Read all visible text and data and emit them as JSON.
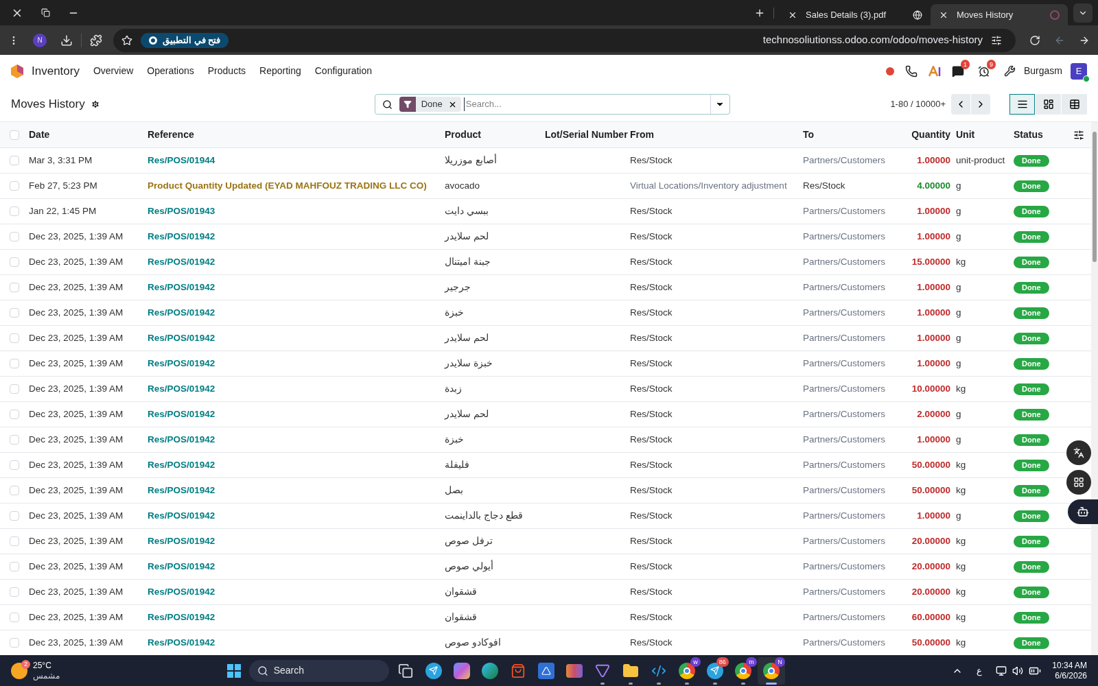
{
  "browser": {
    "tabs": [
      {
        "title": "Sales Details (3).pdf",
        "selected": false
      },
      {
        "title": "Moves History",
        "selected": true
      }
    ],
    "profile": "N",
    "open_in_app": "فتح في التطبيق",
    "url": "technosoliutionss.odoo.com/odoo/moves-history"
  },
  "app": {
    "name": "Inventory",
    "menu": [
      "Overview",
      "Operations",
      "Products",
      "Reporting",
      "Configuration"
    ],
    "chat_count": "1",
    "activity_count": "9",
    "user": "Burgasm",
    "avatar": "E"
  },
  "control": {
    "title": "Moves History",
    "filter": "Done",
    "search_placeholder": "Search...",
    "pager": "1-80 / 10000+",
    "views": [
      {
        "kind": "list",
        "selected": true
      },
      {
        "kind": "kanban",
        "selected": false
      },
      {
        "kind": "pivot",
        "selected": false
      }
    ]
  },
  "table": {
    "select_all_checked": false,
    "columns": [
      "Date",
      "Reference",
      "Product",
      "Lot/Serial Number",
      "From",
      "To",
      "Quantity",
      "Unit",
      "Status"
    ],
    "rows": [
      {
        "kind": "outgoing",
        "selected": false,
        "date": "Mar 3, 3:31 PM",
        "reference": "Res/POS/01944",
        "product": "أصابع موزريلا",
        "from": "Res/Stock",
        "to": "Partners/Customers",
        "quantity": "1.00000",
        "unit": "unit-product",
        "status": "Done"
      },
      {
        "kind": "incoming",
        "selected": false,
        "date": "Feb 27, 5:23 PM",
        "reference": "Product Quantity Updated (EYAD MAHFOUZ TRADING LLC CO)",
        "product": "avocado",
        "from": "Virtual Locations/Inventory adjustment",
        "to": "Res/Stock",
        "quantity": "4.00000",
        "unit": "g",
        "status": "Done"
      },
      {
        "kind": "outgoing",
        "selected": false,
        "date": "Jan 22, 1:45 PM",
        "reference": "Res/POS/01943",
        "product": "ببسي دايت",
        "from": "Res/Stock",
        "to": "Partners/Customers",
        "quantity": "1.00000",
        "unit": "g",
        "status": "Done"
      },
      {
        "kind": "outgoing",
        "selected": false,
        "date": "Dec 23, 2025, 1:39 AM",
        "reference": "Res/POS/01942",
        "product": "لحم سلايدر",
        "from": "Res/Stock",
        "to": "Partners/Customers",
        "quantity": "1.00000",
        "unit": "g",
        "status": "Done"
      },
      {
        "kind": "outgoing",
        "selected": false,
        "date": "Dec 23, 2025, 1:39 AM",
        "reference": "Res/POS/01942",
        "product": "جبنة اميتنال",
        "from": "Res/Stock",
        "to": "Partners/Customers",
        "quantity": "15.00000",
        "unit": "kg",
        "status": "Done"
      },
      {
        "kind": "outgoing",
        "selected": false,
        "date": "Dec 23, 2025, 1:39 AM",
        "reference": "Res/POS/01942",
        "product": "جرجير",
        "from": "Res/Stock",
        "to": "Partners/Customers",
        "quantity": "1.00000",
        "unit": "g",
        "status": "Done"
      },
      {
        "kind": "outgoing",
        "selected": false,
        "date": "Dec 23, 2025, 1:39 AM",
        "reference": "Res/POS/01942",
        "product": "خبزة",
        "from": "Res/Stock",
        "to": "Partners/Customers",
        "quantity": "1.00000",
        "unit": "g",
        "status": "Done"
      },
      {
        "kind": "outgoing",
        "selected": false,
        "date": "Dec 23, 2025, 1:39 AM",
        "reference": "Res/POS/01942",
        "product": "لحم سلايدر",
        "from": "Res/Stock",
        "to": "Partners/Customers",
        "quantity": "1.00000",
        "unit": "g",
        "status": "Done"
      },
      {
        "kind": "outgoing",
        "selected": false,
        "date": "Dec 23, 2025, 1:39 AM",
        "reference": "Res/POS/01942",
        "product": "خبزة سلايدر",
        "from": "Res/Stock",
        "to": "Partners/Customers",
        "quantity": "1.00000",
        "unit": "g",
        "status": "Done"
      },
      {
        "kind": "outgoing",
        "selected": false,
        "date": "Dec 23, 2025, 1:39 AM",
        "reference": "Res/POS/01942",
        "product": "زبدة",
        "from": "Res/Stock",
        "to": "Partners/Customers",
        "quantity": "10.00000",
        "unit": "kg",
        "status": "Done"
      },
      {
        "kind": "outgoing",
        "selected": false,
        "date": "Dec 23, 2025, 1:39 AM",
        "reference": "Res/POS/01942",
        "product": "لحم سلايدر",
        "from": "Res/Stock",
        "to": "Partners/Customers",
        "quantity": "2.00000",
        "unit": "g",
        "status": "Done"
      },
      {
        "kind": "outgoing",
        "selected": false,
        "date": "Dec 23, 2025, 1:39 AM",
        "reference": "Res/POS/01942",
        "product": "خبزة",
        "from": "Res/Stock",
        "to": "Partners/Customers",
        "quantity": "1.00000",
        "unit": "g",
        "status": "Done"
      },
      {
        "kind": "outgoing",
        "selected": false,
        "date": "Dec 23, 2025, 1:39 AM",
        "reference": "Res/POS/01942",
        "product": "فليفلة",
        "from": "Res/Stock",
        "to": "Partners/Customers",
        "quantity": "50.00000",
        "unit": "kg",
        "status": "Done"
      },
      {
        "kind": "outgoing",
        "selected": false,
        "date": "Dec 23, 2025, 1:39 AM",
        "reference": "Res/POS/01942",
        "product": "بصل",
        "from": "Res/Stock",
        "to": "Partners/Customers",
        "quantity": "50.00000",
        "unit": "kg",
        "status": "Done"
      },
      {
        "kind": "outgoing",
        "selected": false,
        "date": "Dec 23, 2025, 1:39 AM",
        "reference": "Res/POS/01942",
        "product": "قطع دجاج بالداينمت",
        "from": "Res/Stock",
        "to": "Partners/Customers",
        "quantity": "1.00000",
        "unit": "g",
        "status": "Done"
      },
      {
        "kind": "outgoing",
        "selected": false,
        "date": "Dec 23, 2025, 1:39 AM",
        "reference": "Res/POS/01942",
        "product": "ترفل صوص",
        "from": "Res/Stock",
        "to": "Partners/Customers",
        "quantity": "20.00000",
        "unit": "kg",
        "status": "Done"
      },
      {
        "kind": "outgoing",
        "selected": false,
        "date": "Dec 23, 2025, 1:39 AM",
        "reference": "Res/POS/01942",
        "product": "أيولي صوص",
        "from": "Res/Stock",
        "to": "Partners/Customers",
        "quantity": "20.00000",
        "unit": "kg",
        "status": "Done"
      },
      {
        "kind": "outgoing",
        "selected": false,
        "date": "Dec 23, 2025, 1:39 AM",
        "reference": "Res/POS/01942",
        "product": "قشقوان",
        "from": "Res/Stock",
        "to": "Partners/Customers",
        "quantity": "20.00000",
        "unit": "kg",
        "status": "Done"
      },
      {
        "kind": "outgoing",
        "selected": false,
        "date": "Dec 23, 2025, 1:39 AM",
        "reference": "Res/POS/01942",
        "product": "قشقوان",
        "from": "Res/Stock",
        "to": "Partners/Customers",
        "quantity": "60.00000",
        "unit": "kg",
        "status": "Done"
      },
      {
        "kind": "outgoing",
        "selected": false,
        "date": "Dec 23, 2025, 1:39 AM",
        "reference": "Res/POS/01942",
        "product": "افوكادو صوص",
        "from": "Res/Stock",
        "to": "Partners/Customers",
        "quantity": "50.00000",
        "unit": "kg",
        "status": "Done"
      }
    ]
  },
  "taskbar": {
    "weather_badge": "2",
    "temperature": "25°C",
    "condition": "مشمس",
    "search": "Search",
    "apps": [
      {
        "kind": "taskview",
        "running": false,
        "selected": false
      },
      {
        "kind": "telegram",
        "running": false,
        "selected": false
      },
      {
        "kind": "copilot",
        "running": false,
        "selected": false
      },
      {
        "kind": "edge",
        "running": false,
        "selected": false
      },
      {
        "kind": "store",
        "running": false,
        "selected": false
      },
      {
        "kind": "azure",
        "running": false,
        "selected": false
      },
      {
        "kind": "awning",
        "running": false,
        "selected": false
      },
      {
        "kind": "vpn",
        "running": true,
        "selected": false
      },
      {
        "kind": "folder",
        "running": true,
        "selected": false
      },
      {
        "kind": "vscode",
        "running": true,
        "selected": false
      },
      {
        "kind": "chrome",
        "badge": "w",
        "running": true,
        "selected": false
      },
      {
        "kind": "telegram",
        "badge": "86",
        "running": true,
        "selected": false
      },
      {
        "kind": "chrome",
        "badge": "m",
        "running": true,
        "selected": false
      },
      {
        "kind": "chrome",
        "badge": "N",
        "running": true,
        "selected": true
      }
    ],
    "language": "ع",
    "time": "10:34 AM",
    "date": "6/6/2026"
  }
}
